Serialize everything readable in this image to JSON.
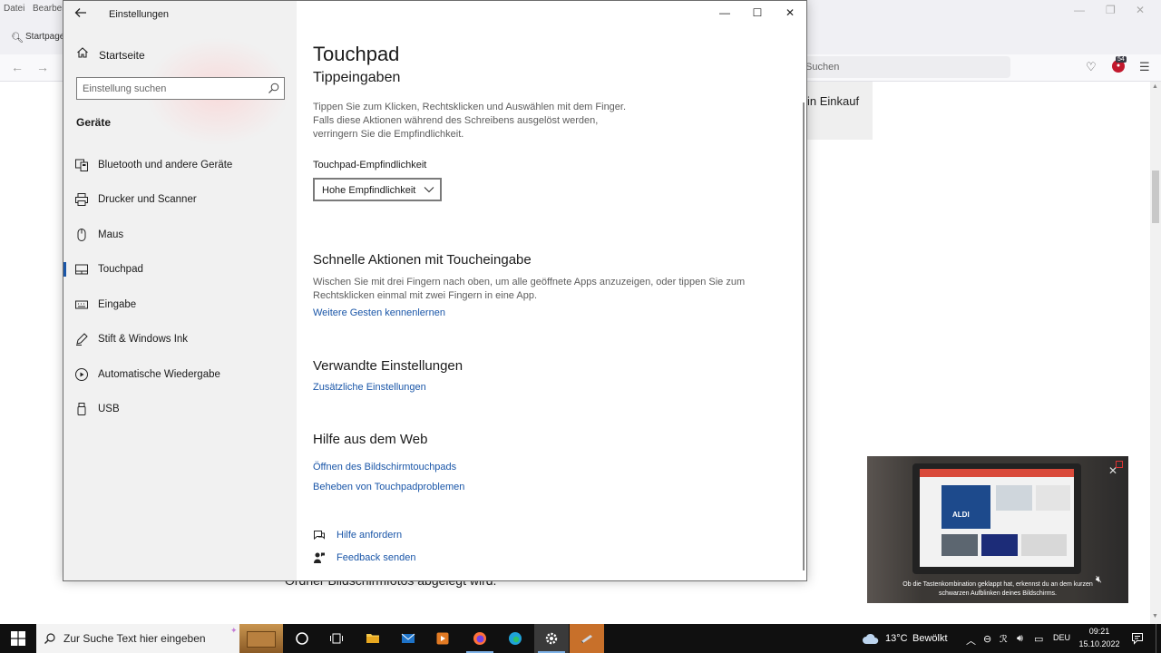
{
  "browser": {
    "menu": [
      "Datei",
      "Bearbeit"
    ],
    "tab_label": "Startpage S",
    "search_text": "Suchen",
    "extension_count": "54",
    "page_card_text": "in Einkauf",
    "page_bottom_text": "Ordner Bildschirmfotos abgelegt wird."
  },
  "video": {
    "caption_line1": "Ob die Tastenkombination geklappt hat, erkennst du an dem kurzen",
    "caption_line2": "schwarzen Aufblinken deines Bildschirms.",
    "logo_text": "ALDI"
  },
  "settings": {
    "window_title": "Einstellungen",
    "home_label": "Startseite",
    "search_placeholder": "Einstellung suchen",
    "section_title": "Geräte",
    "nav_items": [
      {
        "label": "Bluetooth und andere Geräte",
        "icon": "bluetooth-devices-icon"
      },
      {
        "label": "Drucker und Scanner",
        "icon": "printer-icon"
      },
      {
        "label": "Maus",
        "icon": "mouse-icon"
      },
      {
        "label": "Touchpad",
        "icon": "touchpad-icon",
        "active": true
      },
      {
        "label": "Eingabe",
        "icon": "keyboard-icon"
      },
      {
        "label": "Stift & Windows Ink",
        "icon": "pen-icon"
      },
      {
        "label": "Automatische Wiedergabe",
        "icon": "autoplay-icon"
      },
      {
        "label": "USB",
        "icon": "usb-icon"
      }
    ],
    "page_title": "Touchpad",
    "taps_heading": "Tippeingaben",
    "taps_desc": [
      "Tippen Sie zum Klicken, Rechtsklicken und Auswählen mit dem Finger.",
      "Falls diese Aktionen während des Schreibens ausgelöst werden,",
      "verringern Sie die Empfindlichkeit."
    ],
    "sensitivity_label": "Touchpad-Empfindlichkeit",
    "sensitivity_value": "Hohe Empfindlichkeit",
    "quick_heading": "Schnelle Aktionen mit Toucheingabe",
    "quick_desc": [
      "Wischen Sie mit drei Fingern nach oben, um alle geöffnete Apps anzuzeigen, oder tippen Sie zum",
      "Rechtsklicken einmal mit zwei Fingern in eine App."
    ],
    "quick_link": "Weitere Gesten kennenlernen",
    "related_heading": "Verwandte Einstellungen",
    "related_link": "Zusätzliche Einstellungen",
    "web_help_heading": "Hilfe aus dem Web",
    "web_links": [
      "Öffnen des Bildschirmtouchpads",
      "Beheben von Touchpadproblemen"
    ],
    "get_help": "Hilfe anfordern",
    "feedback": "Feedback senden"
  },
  "taskbar": {
    "search_text": "Zur Suche Text hier eingeben",
    "temperature": "13°C",
    "weather": "Bewölkt",
    "language": "DEU",
    "time": "09:21",
    "date": "15.10.2022"
  },
  "colors": {
    "accent": "#1a56a8",
    "sidebar_bg": "#f1f1f1",
    "taskbar_bg": "#101010"
  }
}
